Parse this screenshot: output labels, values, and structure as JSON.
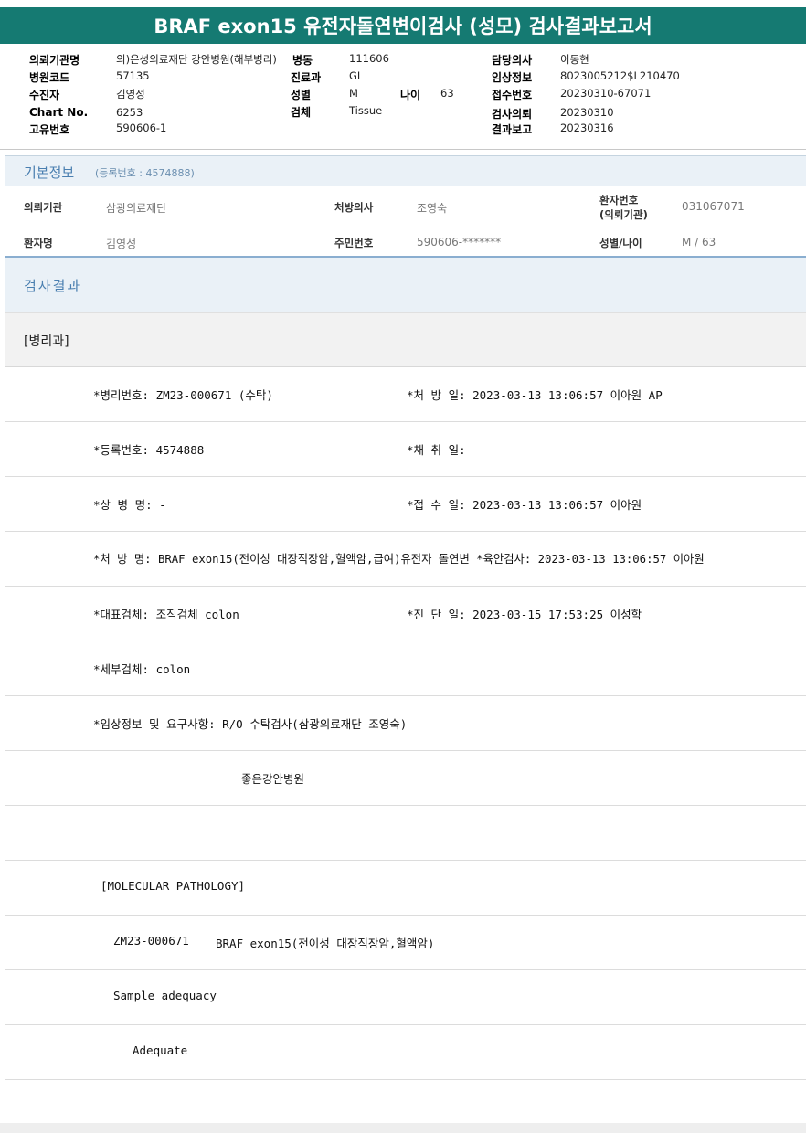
{
  "report": {
    "title": "BRAF exon15 유전자돌연변이검사 (성모) 검사결과보고서"
  },
  "header": {
    "institution_label": "의뢰기관명",
    "institution_value": "의)은성의료재단 강안병원(해부병리)",
    "ward_label": "병동",
    "ward_value": "111606",
    "doctor_label": "담당의사",
    "doctor_value": "이동현",
    "hospital_code_label": "병원코드",
    "hospital_code_value": "57135",
    "dept_label": "진료과",
    "dept_value": "GI",
    "clinical_label": "임상정보",
    "clinical_value": "8023005212$L210470",
    "patient_label": "수진자",
    "patient_value": "김영성",
    "sex_label": "성별",
    "sex_value": "M",
    "age_label": "나이",
    "age_value": "63",
    "reception_label": "접수번호",
    "reception_value": "20230310-67071",
    "chart_label": "Chart No.",
    "chart_value": "6253",
    "specimen_label": "검체",
    "specimen_value": "Tissue",
    "request_label": "검사의뢰",
    "request_value": "20230310",
    "unique_label": "고유번호",
    "unique_value": "590606-1",
    "report_label": "결과보고",
    "report_value": "20230316"
  },
  "basic_info": {
    "title": "기본정보",
    "reg_text": "(등록번호 : 4574888)",
    "row1": {
      "inst_label": "의뢰기관",
      "inst_value": "삼광의료재단",
      "doctor_label": "처방의사",
      "doctor_value": "조영숙",
      "patno_label_1": "환자번호",
      "patno_label_2": "(의뢰기관)",
      "patno_value": "031067071"
    },
    "row2": {
      "name_label": "환자명",
      "name_value": "김영성",
      "rrn_label": "주민번호",
      "rrn_value": "590606-*******",
      "sexage_label": "성별/나이",
      "sexage_value": "M / 63"
    }
  },
  "results": {
    "title": "검사결과",
    "dept": "[병리과]",
    "lines": [
      {
        "left": "*병리번호: ZM23-000671 (수탁)",
        "right": "*처 방 일: 2023-03-13 13:06:57  이아원 AP"
      },
      {
        "left": "*등록번호: 4574888",
        "right": "*채 취 일:"
      },
      {
        "left": "*상 병 명: -",
        "right": "*접 수 일: 2023-03-13 13:06:57  이아원"
      },
      {
        "left": "*처 방 명: BRAF exon15(전이성 대장직장암,혈액암,급여)유전자 돌연변  *육안검사: 2023-03-13 13:06:57  이아원",
        "right": ""
      },
      {
        "left": "*대표검체: 조직검체 colon",
        "right": "*진 단 일: 2023-03-15 17:53:25  이성학"
      },
      {
        "left": "*세부검체: colon",
        "right": ""
      },
      {
        "left": "*임상정보 및 요구사항: R/O 수탁검사(삼광의료재단-조영숙)",
        "right": ""
      }
    ],
    "hospital_line": "좋은강안병원",
    "molecular_header": "[MOLECULAR PATHOLOGY]",
    "molecular_id": "ZM23-000671",
    "molecular_test": "BRAF exon15(전이성 대장직장암,혈액암)",
    "sample_adequacy_label": "Sample adequacy",
    "sample_adequacy_value": "Adequate"
  }
}
